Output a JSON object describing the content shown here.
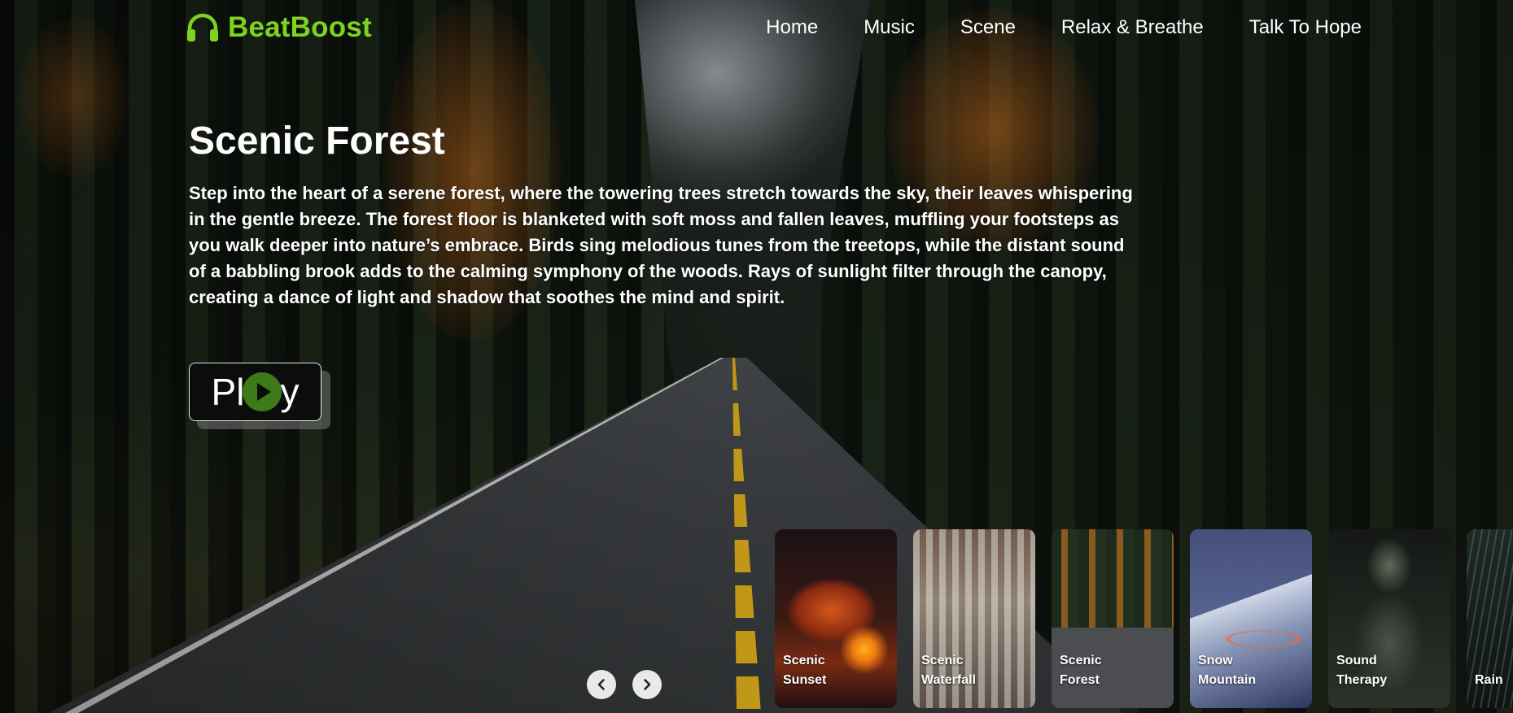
{
  "brand": {
    "name": "BeatBoost",
    "icon": "headphones-icon",
    "color": "#7ed321"
  },
  "nav": {
    "items": [
      {
        "label": "Home"
      },
      {
        "label": "Music"
      },
      {
        "label": "Scene"
      },
      {
        "label": "Relax & Breathe"
      },
      {
        "label": "Talk To Hope"
      }
    ]
  },
  "hero": {
    "title": "Scenic Forest",
    "description": "Step into the heart of a serene forest, where the towering trees stretch towards the sky, their leaves whispering in the gentle breeze. The forest floor is blanketed with soft moss and fallen leaves, muffling your footsteps as you walk deeper into nature’s embrace. Birds sing melodious tunes from the treetops, while the distant sound of a babbling brook adds to the calming symphony of the woods. Rays of sunlight filter through the canopy, creating a dance of light and shadow that soothes the mind and spirit.",
    "play_button": {
      "label_before": "Pl",
      "icon": "play-icon",
      "label_after": "y",
      "accent": "#3d7a18"
    }
  },
  "carousel": {
    "prev_icon": "chevron-left-icon",
    "next_icon": "chevron-right-icon",
    "cards": [
      {
        "line1": "Scenic",
        "line2": "Sunset"
      },
      {
        "line1": "Scenic",
        "line2": "Waterfall"
      },
      {
        "line1": "Scenic",
        "line2": "Forest"
      },
      {
        "line1": "Snow",
        "line2": "Mountain"
      },
      {
        "line1": "Sound",
        "line2": "Therapy"
      },
      {
        "line1": "Rain",
        "line2": ""
      }
    ]
  }
}
